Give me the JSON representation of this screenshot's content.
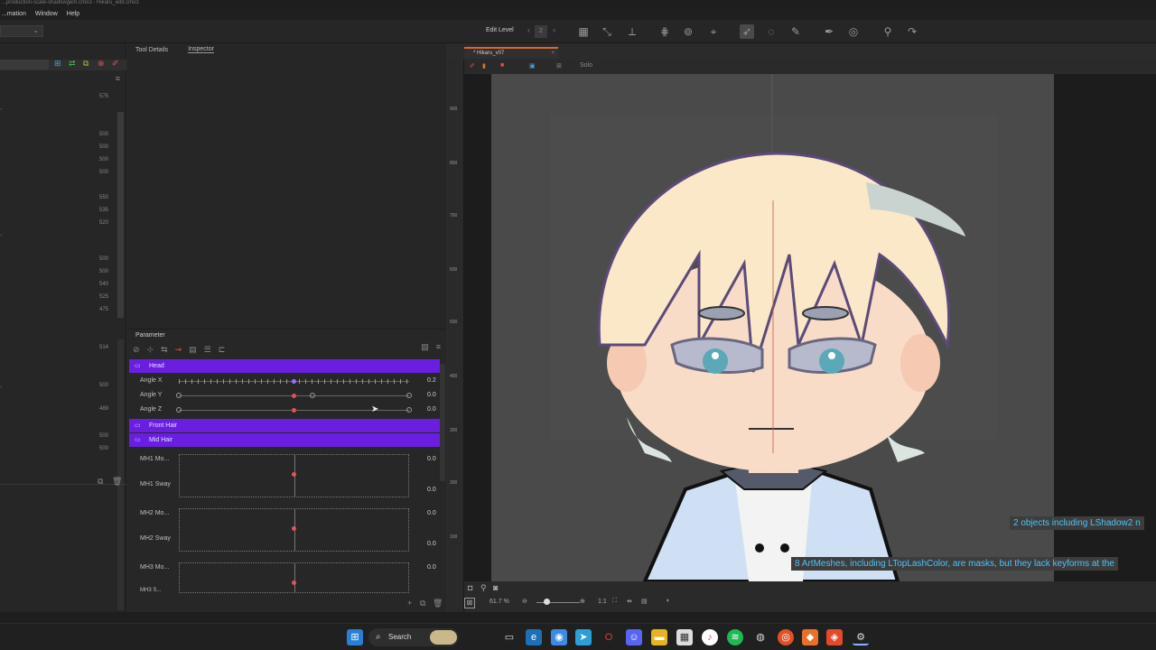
{
  "window": {
    "title": "...production-scale-shadowgem.cmo3 - Hikaru_edit.cmo3"
  },
  "menu": {
    "items": [
      "...mation",
      "Window",
      "Help"
    ]
  },
  "toolbar": {
    "edit_level_label": "Edit Level",
    "edit_level_value": "2"
  },
  "inspector": {
    "tabs": [
      "Tool Details",
      "Inspector"
    ]
  },
  "left_panel": {
    "numbers": [
      "575",
      "500",
      "500",
      "500",
      "500",
      "550",
      "535",
      "520",
      "500",
      "500",
      "540",
      "525",
      "475",
      "514",
      "500",
      "489",
      "500",
      "500"
    ]
  },
  "parameter": {
    "title": "Parameter",
    "groups": [
      "Head",
      "Front Hair",
      "Mid Hair"
    ],
    "head_params": [
      {
        "name": "Angle X",
        "value": "0.2"
      },
      {
        "name": "Angle Y",
        "value": "0.0"
      },
      {
        "name": "Angle Z",
        "value": "0.0"
      }
    ],
    "hair_params": [
      {
        "name": "MH1 Mo...",
        "value": "0.0"
      },
      {
        "name": "MH1 Sway",
        "value": "0.0"
      },
      {
        "name": "MH2 Mo...",
        "value": "0.0"
      },
      {
        "name": "MH2 Sway",
        "value": "0.0"
      },
      {
        "name": "MH3 Mo...",
        "value": "0.0"
      },
      {
        "name": "MH3 S...",
        "value": ""
      }
    ]
  },
  "document": {
    "tab": "* Hikaru_v07",
    "view_mode": "Solo"
  },
  "ruler": {
    "labels": [
      "900",
      "800",
      "700",
      "600",
      "500",
      "400",
      "300",
      "200",
      "100"
    ]
  },
  "viewport": {
    "zoom": "61.7 %",
    "ratio": "1:1"
  },
  "messages": [
    "2 objects including LShadow2 n",
    "8 ArtMeshes, including LTopLashColor, are masks, but they lack keyforms at the"
  ],
  "taskbar": {
    "search_label": "Search"
  },
  "colors": {
    "group": "#6a1fe0",
    "accent": "#d9662b",
    "knob": "#e15454",
    "message": "#4fc3f7"
  }
}
